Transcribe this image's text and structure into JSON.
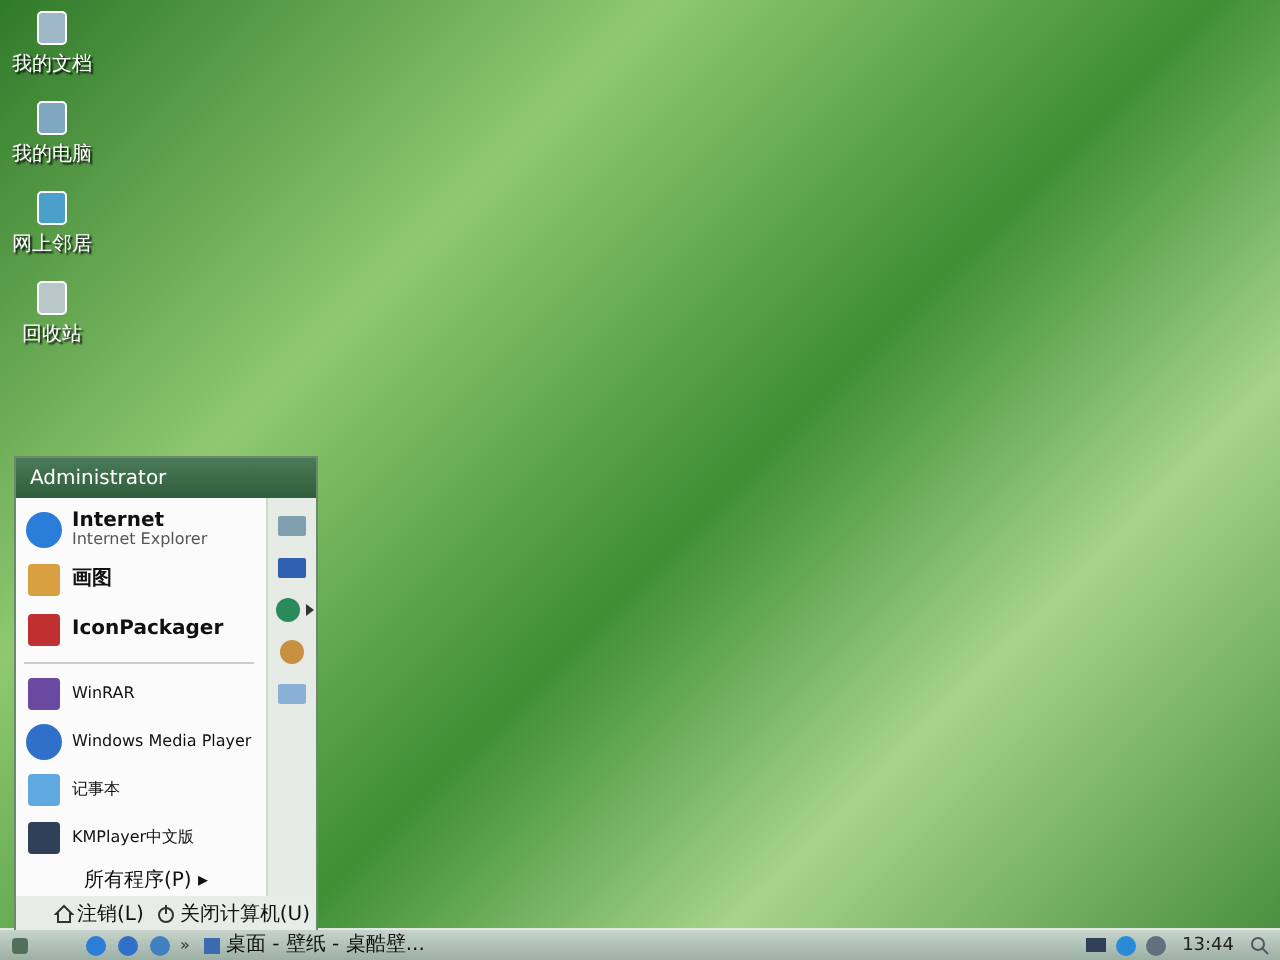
{
  "desktop_icons": [
    {
      "label": "我的文档"
    },
    {
      "label": "我的电脑"
    },
    {
      "label": "网上邻居"
    },
    {
      "label": "回收站"
    }
  ],
  "start_menu": {
    "user": "Administrator",
    "programs": [
      {
        "title": "Internet",
        "subtitle": "Internet Explorer",
        "kind": "pinned"
      },
      {
        "title": "画图",
        "kind": "pinned"
      },
      {
        "title": "IconPackager",
        "kind": "pinned"
      },
      {
        "title": "WinRAR",
        "kind": "recent"
      },
      {
        "title": "Windows Media Player",
        "kind": "recent"
      },
      {
        "title": "记事本",
        "kind": "recent"
      },
      {
        "title": "KMPlayer中文版",
        "kind": "recent"
      }
    ],
    "places": [
      {
        "submenu": false
      },
      {
        "submenu": false
      },
      {
        "submenu": true
      },
      {
        "submenu": false
      },
      {
        "submenu": false
      }
    ],
    "all_programs": "所有程序(P)",
    "all_programs_arrow": "▸",
    "log_off": "注销(L)",
    "shut_down": "关闭计算机(U)"
  },
  "taskbar": {
    "overflow": "»",
    "task": "桌面 - 壁纸 - 桌酷壁...",
    "clock": "13:44"
  }
}
